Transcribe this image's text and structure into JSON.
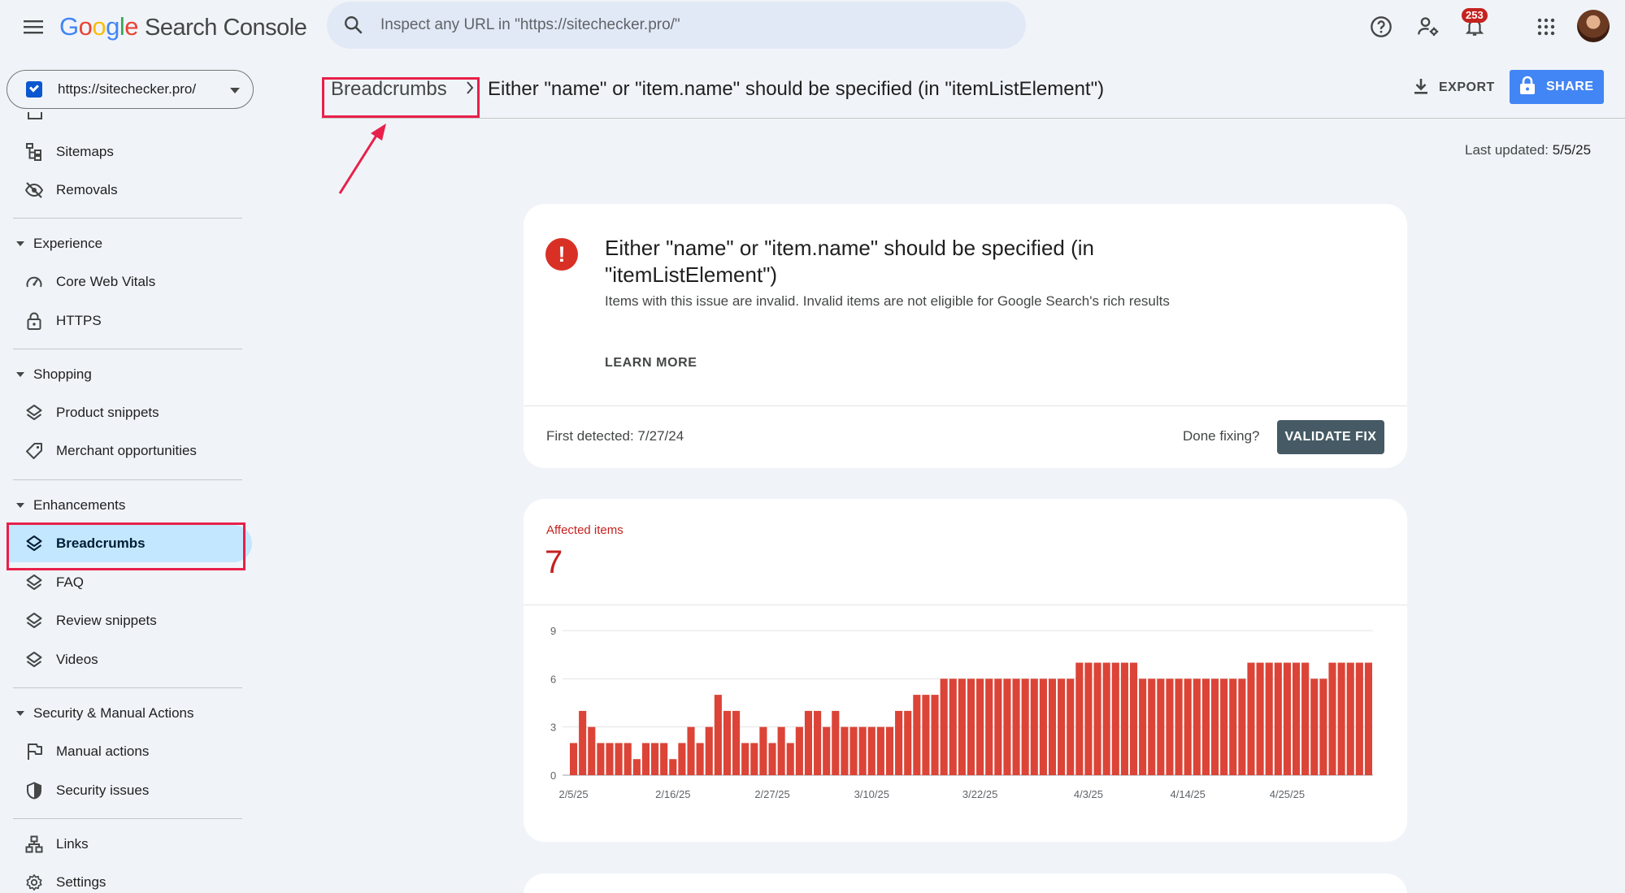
{
  "app": {
    "logo_letters": [
      "G",
      "o",
      "o",
      "g",
      "l",
      "e"
    ],
    "product_name": "Search Console"
  },
  "search": {
    "placeholder": "Inspect any URL in \"https://sitechecker.pro/\""
  },
  "notifications": {
    "count": "253"
  },
  "property": {
    "label": "https://sitechecker.pro/"
  },
  "sidebar": {
    "items_top": [
      {
        "label": "Sitemaps",
        "icon": "sitemap-icon"
      },
      {
        "label": "Removals",
        "icon": "eye-off-icon"
      }
    ],
    "sections": [
      {
        "label": "Experience",
        "items": [
          {
            "label": "Core Web Vitals",
            "icon": "speed-gauge-icon"
          },
          {
            "label": "HTTPS",
            "icon": "lock-icon"
          }
        ]
      },
      {
        "label": "Shopping",
        "items": [
          {
            "label": "Product snippets",
            "icon": "layers-icon"
          },
          {
            "label": "Merchant opportunities",
            "icon": "tag-icon"
          }
        ]
      },
      {
        "label": "Enhancements",
        "items": [
          {
            "label": "Breadcrumbs",
            "icon": "layers-icon",
            "active": true
          },
          {
            "label": "FAQ",
            "icon": "layers-icon"
          },
          {
            "label": "Review snippets",
            "icon": "layers-icon"
          },
          {
            "label": "Videos",
            "icon": "layers-icon"
          }
        ]
      },
      {
        "label": "Security & Manual Actions",
        "items": [
          {
            "label": "Manual actions",
            "icon": "flag-icon"
          },
          {
            "label": "Security issues",
            "icon": "shield-icon"
          }
        ]
      }
    ],
    "items_bottom": [
      {
        "label": "Links",
        "icon": "links-icon"
      },
      {
        "label": "Settings",
        "icon": "gear-icon"
      }
    ]
  },
  "header": {
    "breadcrumb_parent": "Breadcrumbs",
    "breadcrumb_current": "Either \"name\" or \"item.name\" should be specified (in \"itemListElement\")",
    "export_label": "EXPORT",
    "share_label": "SHARE"
  },
  "last_updated": {
    "label": "Last updated:",
    "date": "5/5/25"
  },
  "issue": {
    "title": "Either \"name\" or \"item.name\" should be specified (in \"itemListElement\")",
    "description": "Items with this issue are invalid. Invalid items are not eligible for Google Search's rich results",
    "learn_more": "LEARN MORE",
    "first_detected": "First detected: 7/27/24",
    "done_fixing": "Done fixing?",
    "validate_label": "VALIDATE FIX"
  },
  "affected": {
    "label": "Affected items",
    "value": "7"
  },
  "colors": {
    "accent_blue": "#4285f4",
    "error_red": "#d93025",
    "bar_red": "#db4437",
    "active_nav": "#c2e7ff",
    "highlight_pink": "#e8204a"
  },
  "chart_data": {
    "type": "bar",
    "title": "",
    "xlabel": "",
    "ylabel": "",
    "ylim": [
      0,
      9
    ],
    "yticks": [
      0,
      3,
      6,
      9
    ],
    "grid": true,
    "x_tick_labels": [
      {
        "label": "2/5/25",
        "index": 0
      },
      {
        "label": "2/16/25",
        "index": 11
      },
      {
        "label": "2/27/25",
        "index": 22
      },
      {
        "label": "3/10/25",
        "index": 33
      },
      {
        "label": "3/22/25",
        "index": 45
      },
      {
        "label": "4/3/25",
        "index": 57
      },
      {
        "label": "4/14/25",
        "index": 68
      },
      {
        "label": "4/25/25",
        "index": 79
      }
    ],
    "series": [
      {
        "values": [
          2,
          4,
          3,
          2,
          2,
          2,
          2,
          1,
          2,
          2,
          2,
          1,
          2,
          3,
          2,
          3,
          5,
          4,
          4,
          2,
          2,
          3,
          2,
          3,
          2,
          3,
          4,
          4,
          3,
          4,
          3,
          3,
          3,
          3,
          3,
          3,
          4,
          4,
          5,
          5,
          5,
          6,
          6,
          6,
          6,
          6,
          6,
          6,
          6,
          6,
          6,
          6,
          6,
          6,
          6,
          6,
          7,
          7,
          7,
          7,
          7,
          7,
          7,
          6,
          6,
          6,
          6,
          6,
          6,
          6,
          6,
          6,
          6,
          6,
          6,
          7,
          7,
          7,
          7,
          7,
          7,
          7,
          6,
          6,
          7,
          7,
          7,
          7,
          7
        ]
      }
    ]
  }
}
